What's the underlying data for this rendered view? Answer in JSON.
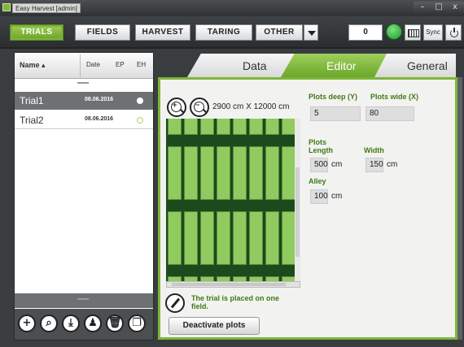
{
  "window": {
    "title": "Easy Harvest [admin]",
    "minimize": "–",
    "maximize": "□",
    "close": "x"
  },
  "menu": {
    "trials": "TRIALS",
    "fields": "FIELDS",
    "harvest": "HARVEST",
    "taring": "TARING",
    "other": "OTHER",
    "counter": "0",
    "sync": "Sync"
  },
  "list": {
    "headers": {
      "name": "Name ▴",
      "date": "Date",
      "ep": "EP",
      "eh": "EH"
    },
    "rows": [
      {
        "name": "Trial1",
        "date": "08.06.2016",
        "selected": true
      },
      {
        "name": "Trial2",
        "date": "08.06.2016",
        "selected": false
      }
    ]
  },
  "toolbar_icons": [
    "add-icon",
    "search-icon",
    "download-icon",
    "user-icon",
    "delete-icon",
    "copy-icon"
  ],
  "toolbar_glyphs": {
    "add": "+",
    "search": "⌕",
    "download": "⤓",
    "user": "♟",
    "delete": "🗑",
    "copy": "❐"
  },
  "tabs": {
    "data": "Data",
    "editor": "Editor",
    "general": "General"
  },
  "editor": {
    "zoom_in": "+",
    "zoom_out": "−",
    "dimensions": "2900 cm X 12000 cm",
    "plots_deep_label": "Plots deep (Y)",
    "plots_deep_value": "5",
    "plots_wide_label": "Plots wide (X)",
    "plots_wide_value": "80",
    "plots_length_label": "Plots\nLength",
    "plots_length_value": "500",
    "plots_length_unit": "cm",
    "width_label": "Width",
    "width_value": "150",
    "width_unit": "cm",
    "alley_label": "Alley",
    "alley_value": "100",
    "alley_unit": "cm",
    "placed_message": "The trial is placed on one field.",
    "deactivate_button": "Deactivate plots"
  },
  "colors": {
    "accent_green": "#7db63a",
    "label_green": "#3f7a16",
    "field_dark": "#1c4a1c",
    "plot_green": "#8fcb5f"
  }
}
